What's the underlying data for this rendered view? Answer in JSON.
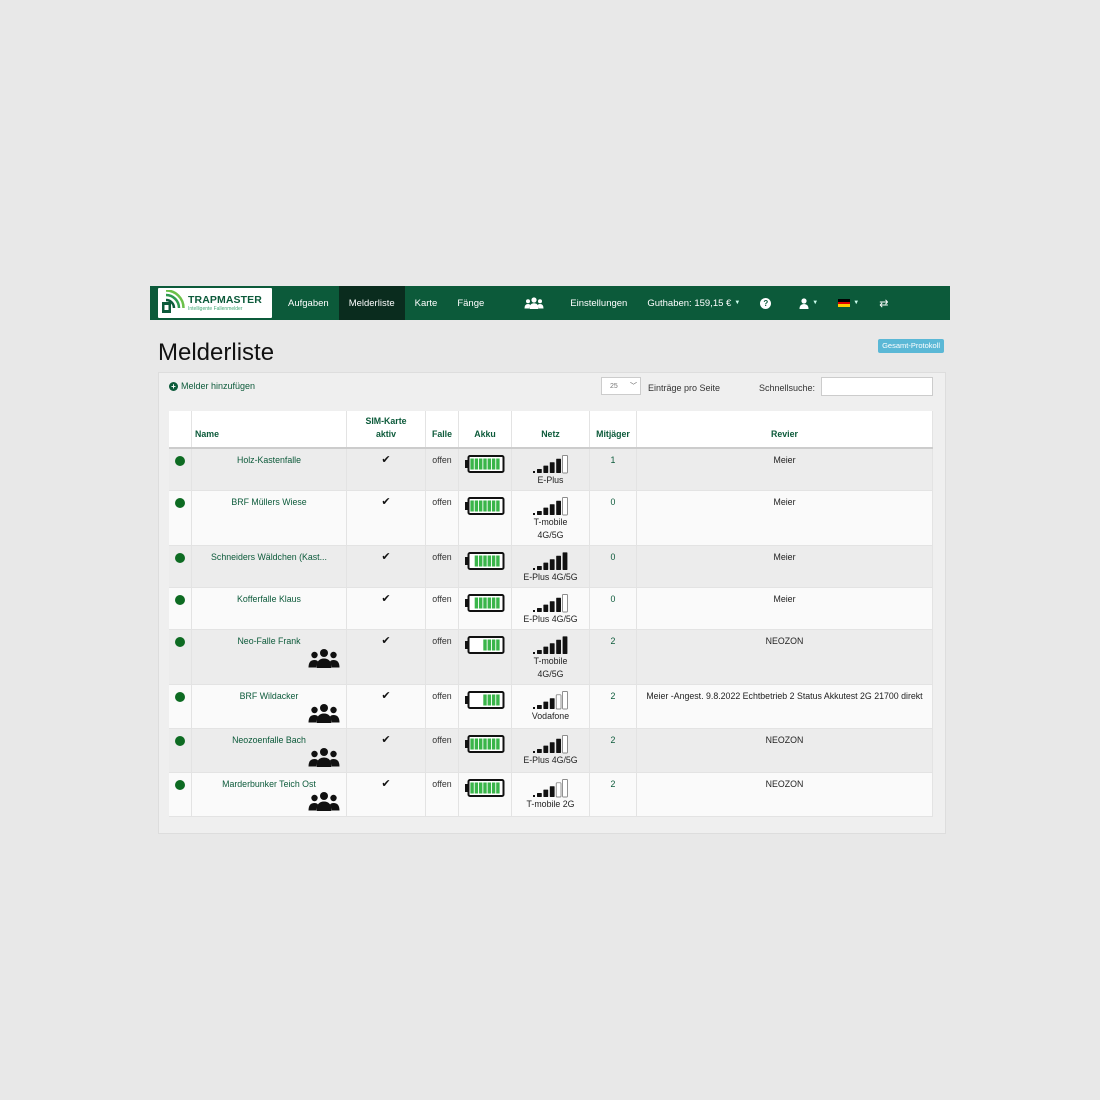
{
  "brand": {
    "name": "TRAPMASTER",
    "subtitle": "Intelligente Fallenmelder"
  },
  "nav": {
    "items": [
      {
        "label": "Aufgaben",
        "active": false
      },
      {
        "label": "Melderliste",
        "active": true
      },
      {
        "label": "Karte",
        "active": false
      },
      {
        "label": "Fänge",
        "active": false
      }
    ],
    "settings_label": "Einstellungen",
    "balance_label": "Guthaben: 159,15 €",
    "help_glyph": "?",
    "icons": [
      "group-icon",
      "help-icon",
      "user-icon",
      "german-flag-icon",
      "switch-icon"
    ]
  },
  "page": {
    "title": "Melderliste",
    "protocol_button": "Gesamt-Protokoll"
  },
  "toolbar": {
    "add_label": "Melder hinzufügen",
    "per_page_value": "25",
    "per_page_label": "Einträge pro Seite",
    "search_label": "Schnellsuche:"
  },
  "table": {
    "headers": {
      "name": "Name",
      "sim_line1": "SIM-Karte",
      "sim_line2": "aktiv",
      "falle": "Falle",
      "akku": "Akku",
      "netz": "Netz",
      "mitjaeger": "Mitjäger",
      "revier": "Revier"
    },
    "rows": [
      {
        "name": "Holz-Kastenfalle",
        "group": false,
        "sim": "✔",
        "falle": "offen",
        "battery_level": 1.0,
        "signal": 4,
        "netz_lines": [
          "E-Plus"
        ],
        "mitjaeger": "1",
        "revier": "Meier"
      },
      {
        "name": "BRF Müllers Wiese",
        "group": false,
        "sim": "✔",
        "falle": "offen",
        "battery_level": 1.0,
        "signal": 4,
        "netz_lines": [
          "T-mobile",
          "4G/5G"
        ],
        "mitjaeger": "0",
        "revier": "Meier"
      },
      {
        "name": "Schneiders Wäldchen (Kast...",
        "group": false,
        "sim": "✔",
        "falle": "offen",
        "battery_level": 0.8,
        "signal": 5,
        "netz_lines": [
          "E-Plus 4G/5G"
        ],
        "mitjaeger": "0",
        "revier": "Meier"
      },
      {
        "name": "Kofferfalle Klaus",
        "group": false,
        "sim": "✔",
        "falle": "offen",
        "battery_level": 0.8,
        "signal": 4,
        "netz_lines": [
          "E-Plus 4G/5G"
        ],
        "mitjaeger": "0",
        "revier": "Meier"
      },
      {
        "name": "Neo-Falle Frank",
        "group": true,
        "sim": "✔",
        "falle": "offen",
        "battery_level": 0.6,
        "signal": 5,
        "netz_lines": [
          "T-mobile",
          "4G/5G"
        ],
        "mitjaeger": "2",
        "revier": "NEOZON"
      },
      {
        "name": "BRF Wildacker",
        "group": true,
        "sim": "✔",
        "falle": "offen",
        "battery_level": 0.6,
        "signal": 3,
        "netz_lines": [
          "Vodafone"
        ],
        "mitjaeger": "2",
        "revier": "Meier -Angest. 9.8.2022 Echtbetrieb 2 Status Akkutest 2G 21700 direkt"
      },
      {
        "name": "Neozoenfalle Bach",
        "group": true,
        "sim": "✔",
        "falle": "offen",
        "battery_level": 1.0,
        "signal": 4,
        "netz_lines": [
          "E-Plus 4G/5G"
        ],
        "mitjaeger": "2",
        "revier": "NEOZON"
      },
      {
        "name": "Marderbunker Teich Ost",
        "group": true,
        "sim": "✔",
        "falle": "offen",
        "battery_level": 1.0,
        "signal": 3,
        "netz_lines": [
          "T-mobile 2G"
        ],
        "mitjaeger": "2",
        "revier": "NEOZON"
      }
    ]
  },
  "colors": {
    "navbar": "#0c5a3a",
    "active_nav": "#0a2c1e",
    "status_dot": "#0d6b22",
    "battery_fill": "#3ab54a",
    "button": "#5bb8d6"
  }
}
